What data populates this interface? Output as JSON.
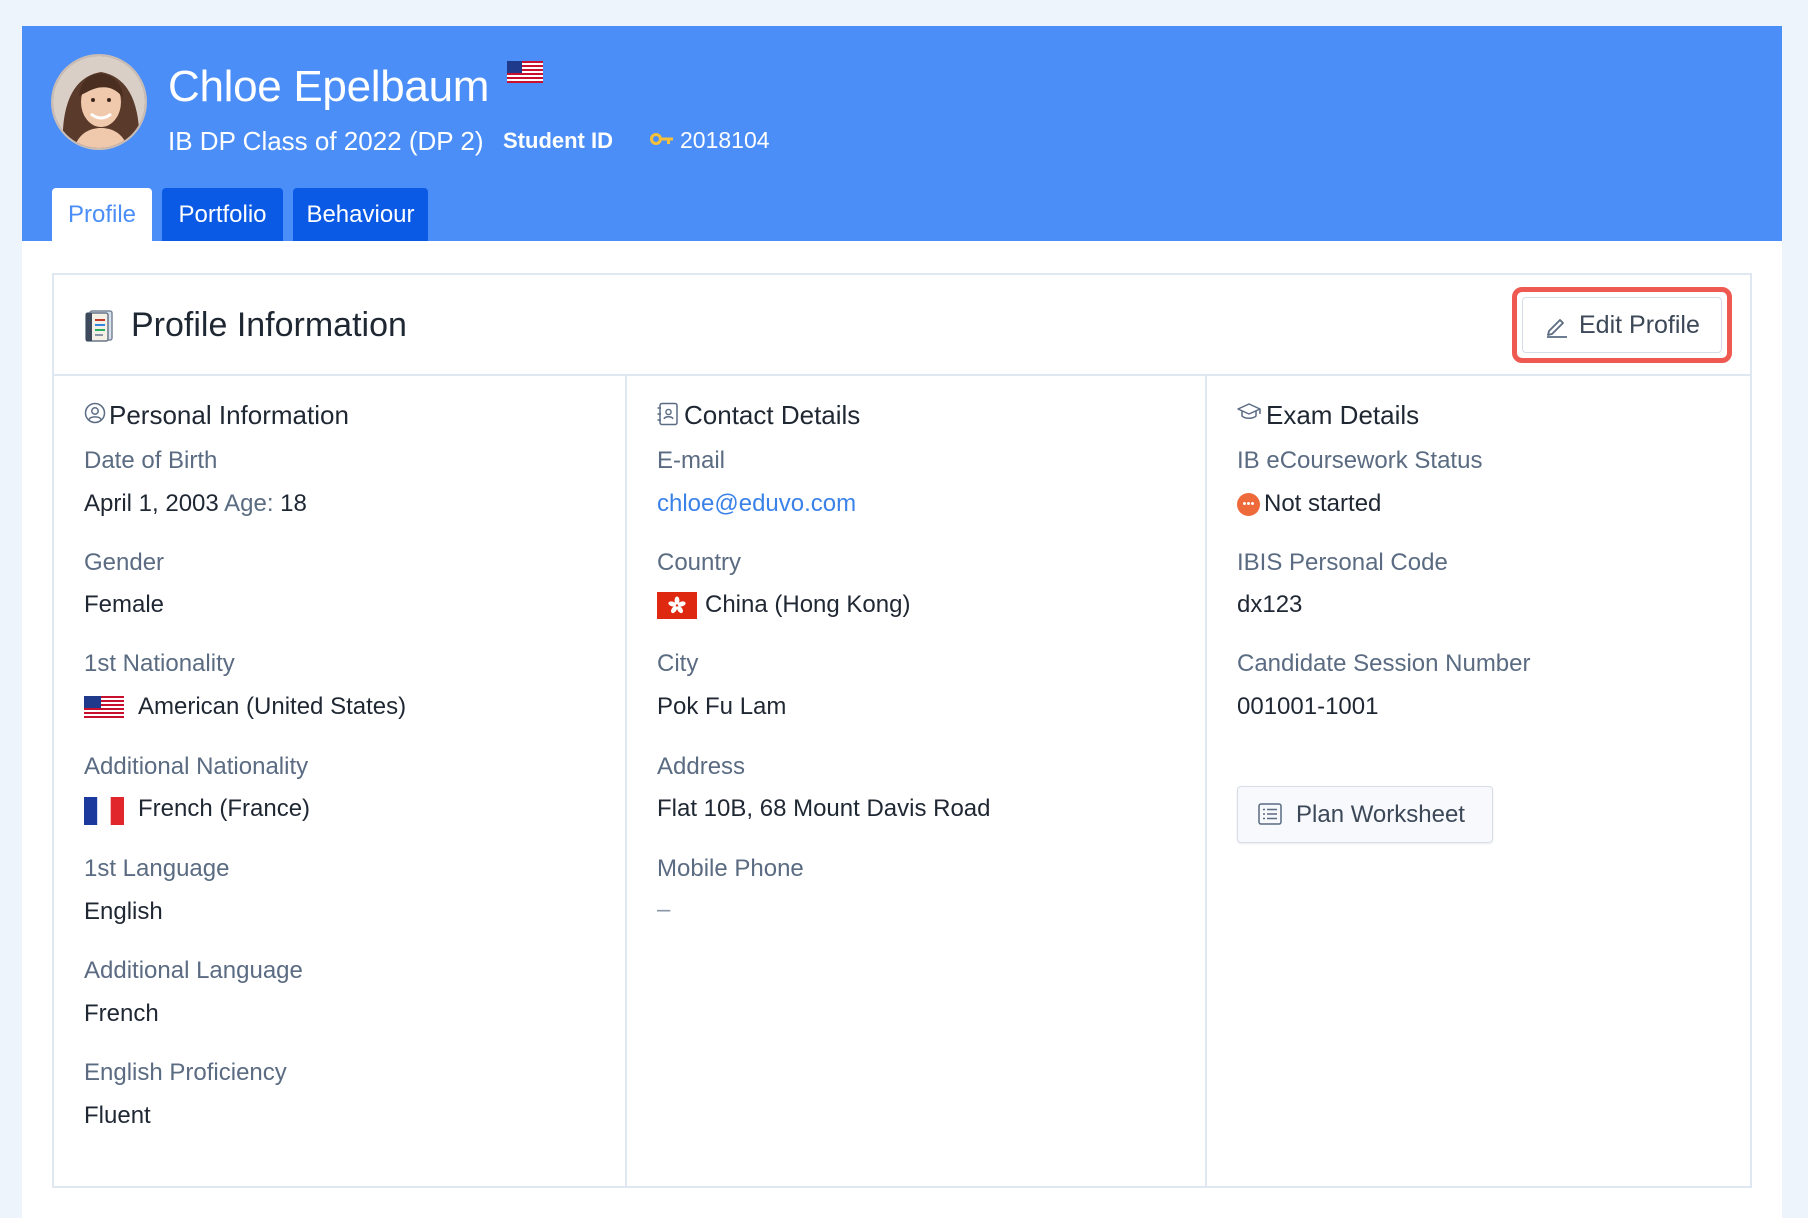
{
  "student": {
    "name": "Chloe Epelbaum",
    "class": "IB DP Class of 2022 (DP 2)",
    "id_label": "Student ID",
    "id_value": "2018104"
  },
  "tabs": [
    {
      "label": "Profile",
      "active": true
    },
    {
      "label": "Portfolio",
      "active": false
    },
    {
      "label": "Behaviour",
      "active": false
    }
  ],
  "card": {
    "title": "Profile Information",
    "edit_label": "Edit Profile"
  },
  "personal": {
    "title": "Personal Information",
    "dob_label": "Date of Birth",
    "dob_value": "April 1, 2003",
    "age_label": "Age:",
    "age_value": "18",
    "gender_label": "Gender",
    "gender_value": "Female",
    "nationality1_label": "1st Nationality",
    "nationality1_value": "American (United States)",
    "nationality2_label": "Additional Nationality",
    "nationality2_value": "French (France)",
    "language1_label": "1st Language",
    "language1_value": "English",
    "language2_label": "Additional Language",
    "language2_value": "French",
    "proficiency_label": "English Proficiency",
    "proficiency_value": "Fluent"
  },
  "contact": {
    "title": "Contact Details",
    "email_label": "E-mail",
    "email_value": "chloe@eduvo.com",
    "country_label": "Country",
    "country_value": "China (Hong Kong)",
    "city_label": "City",
    "city_value": "Pok Fu Lam",
    "address_label": "Address",
    "address_value": "Flat 10B, 68 Mount Davis Road",
    "phone_label": "Mobile Phone",
    "phone_value": "–"
  },
  "exam": {
    "title": "Exam Details",
    "ecoursework_label": "IB eCoursework Status",
    "ecoursework_value": "Not started",
    "ibis_label": "IBIS Personal Code",
    "ibis_value": "dx123",
    "session_label": "Candidate Session Number",
    "session_value": "001001-1001",
    "plan_label": "Plan Worksheet"
  },
  "colors": {
    "hero_blue": "#4b8ef7",
    "tab_dark_blue": "#0a5ae6",
    "link_blue": "#3b82e8",
    "highlight_red": "#ee5a52",
    "status_orange": "#ef6a3a"
  },
  "icons": {
    "hero_flag": "us-flag-icon",
    "key": "key-icon",
    "card_title": "notebook-icon",
    "edit": "pencil-icon",
    "personal": "user-circle-icon",
    "contact": "contact-book-icon",
    "exam": "graduation-cap-icon",
    "plan": "list-icon"
  }
}
